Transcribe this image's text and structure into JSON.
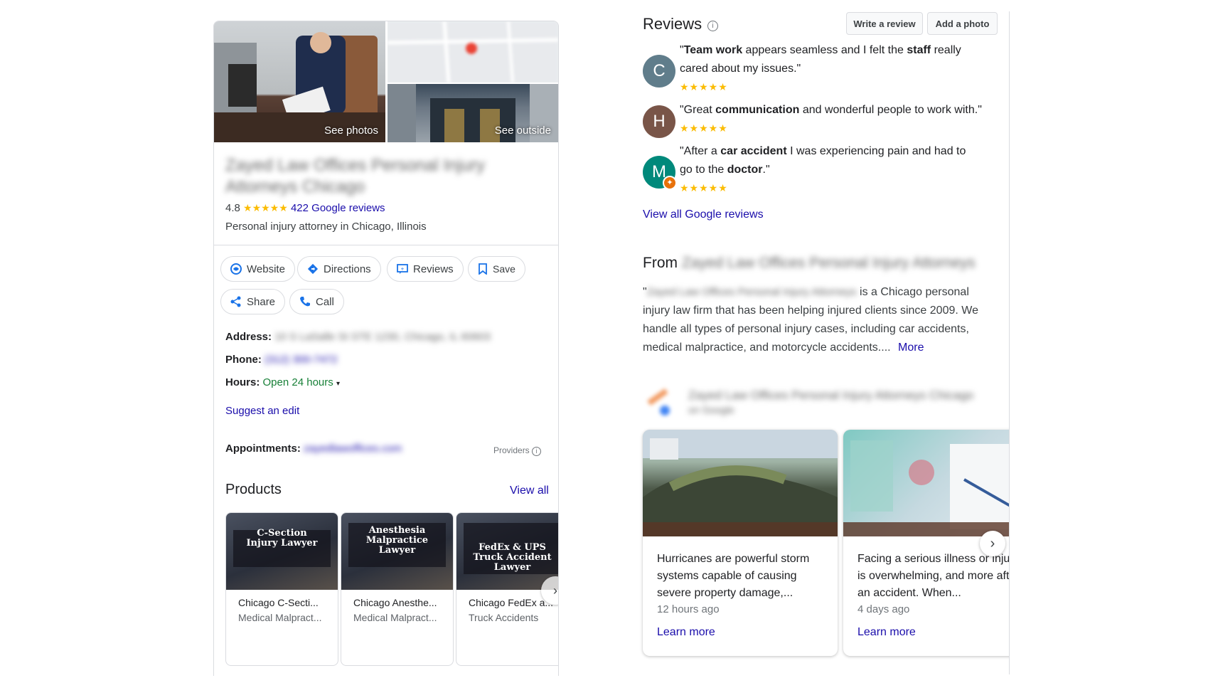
{
  "left_panel": {
    "photos": {
      "see_photos": "See photos",
      "see_outside": "See outside"
    },
    "business_name": "Zayed Law Offices Personal Injury Attorneys Chicago",
    "rating": "4.8",
    "stars": "★★★★★",
    "reviews_count_label": "422 Google reviews",
    "category": "Personal injury attorney in Chicago, Illinois",
    "actions": {
      "website": "Website",
      "directions": "Directions",
      "reviews": "Reviews",
      "save": "Save",
      "share": "Share",
      "call": "Call"
    },
    "address_label": "Address:",
    "address_value": "10 S LaSalle St STE 1230, Chicago, IL 60603",
    "phone_label": "Phone:",
    "phone_value": "(312) 300-7472",
    "hours_label": "Hours:",
    "hours_value": "Open 24 hours",
    "suggest_edit": "Suggest an edit",
    "appointments_label": "Appointments:",
    "appointments_value": "zayedlawoffices.com",
    "providers": "Providers",
    "products_title": "Products",
    "view_all": "View all",
    "products": [
      {
        "image_title": "C-Section Injury Lawyer",
        "name": "Chicago C-Secti...",
        "category": "Medical Malpract..."
      },
      {
        "image_title": "Anesthesia Malpractice Lawyer",
        "name": "Chicago Anesthe...",
        "category": "Medical Malpract..."
      },
      {
        "image_title": "FedEx & UPS Truck Accident Lawyer",
        "name": "Chicago FedEx a...",
        "category": "Truck Accidents"
      }
    ]
  },
  "right_panel": {
    "reviews_title": "Reviews",
    "write_review": "Write a review",
    "add_photo": "Add a photo",
    "reviews": [
      {
        "initial": "C",
        "color": "#607d8b",
        "parts": [
          [
            "\"",
            false
          ],
          [
            "Team work",
            true
          ],
          [
            " appears seamless and I felt the ",
            false
          ],
          [
            "staff",
            true
          ],
          [
            " really cared about my issues.\"",
            false
          ]
        ],
        "stars": "★★★★★"
      },
      {
        "initial": "H",
        "color": "#795548",
        "parts": [
          [
            "\"Great ",
            false
          ],
          [
            "communication",
            true
          ],
          [
            " and wonderful people to work with.\"",
            false
          ]
        ],
        "stars": "★★★★★"
      },
      {
        "initial": "M",
        "color": "#00897b",
        "parts": [
          [
            "\"After a ",
            false
          ],
          [
            "car accident",
            true
          ],
          [
            " I was experiencing pain and had to go to the ",
            false
          ],
          [
            "doctor",
            true
          ],
          [
            ".\"",
            false
          ]
        ],
        "stars": "★★★★★"
      }
    ],
    "view_all_reviews": "View all Google reviews",
    "from_label": "From",
    "from_name": "Zayed Law Offices Personal Injury Attorneys",
    "description_blurred": "Zayed Law Offices Personal Injury Attorneys",
    "description_prefix": "\"",
    "description": " is a Chicago personal injury law firm that has been helping injured clients since 2009. We handle all types of personal injury cases, including car accidents, medical malpractice, and motorcycle accidents....",
    "more": "More",
    "posts_author": "Zayed Law Offices Personal Injury Attorneys Chicago",
    "posts_source": "on Google",
    "news": [
      {
        "text": "Hurricanes are powerful storm systems capable of causing severe property damage,...",
        "time": "12 hours ago",
        "link": "Learn more"
      },
      {
        "text": "Facing a serious illness or injury is overwhelming, and more after an accident. When...",
        "time": "4 days ago",
        "link": "Learn more"
      }
    ]
  },
  "colors": {
    "link": "#1a0dab",
    "open": "#188038",
    "star": "#fbbc04",
    "border": "#dadce0"
  }
}
